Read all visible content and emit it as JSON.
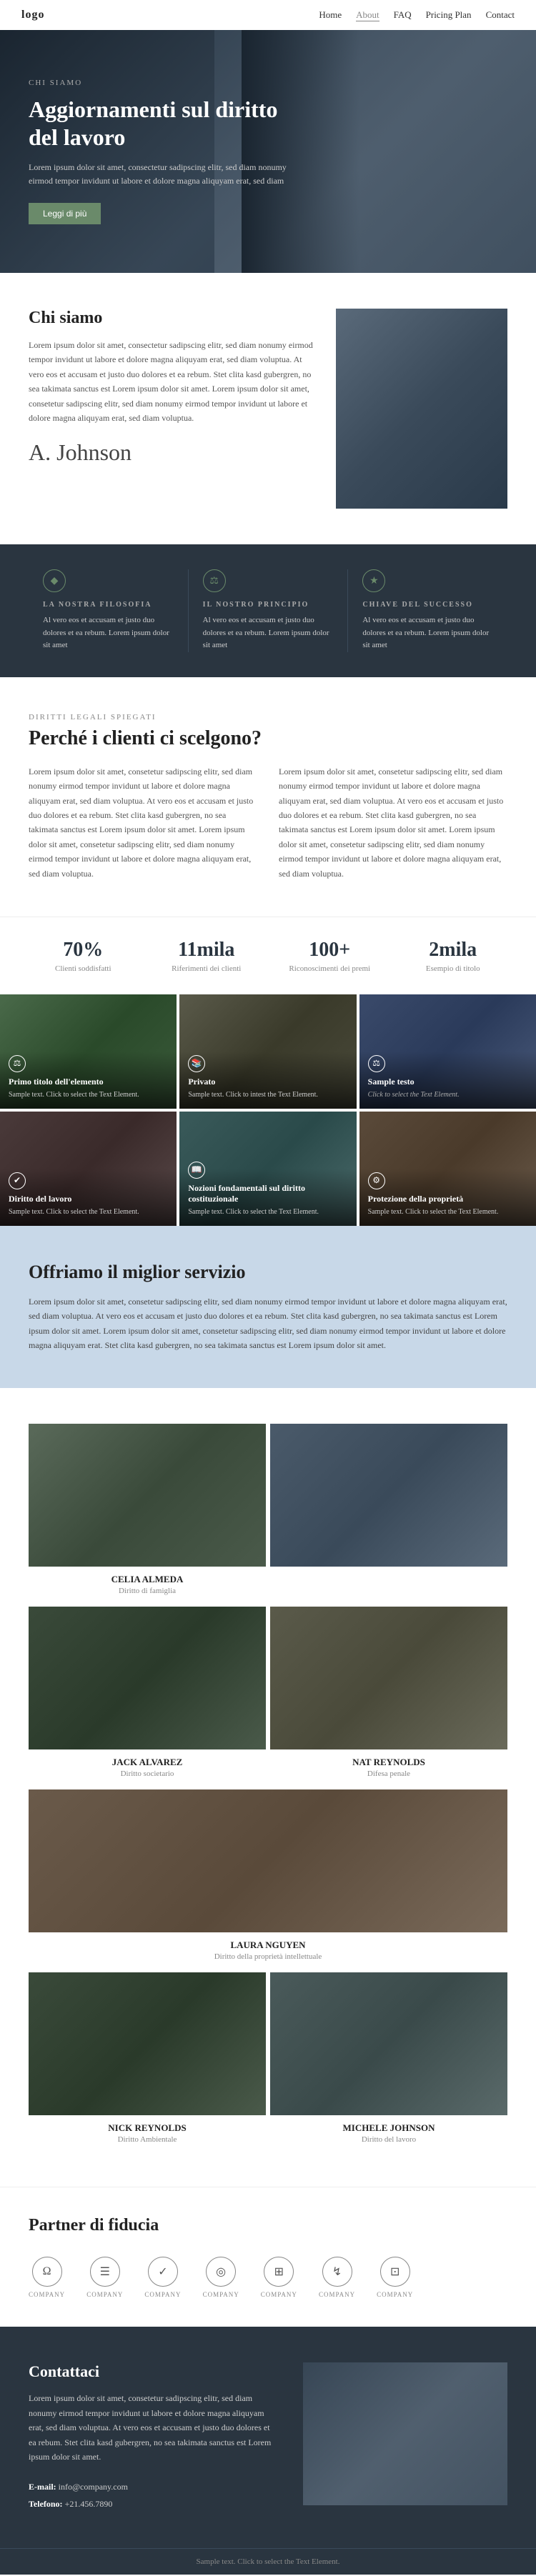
{
  "nav": {
    "logo": "logo",
    "links": [
      {
        "label": "Home",
        "active": false
      },
      {
        "label": "About",
        "active": true
      },
      {
        "label": "FAQ",
        "active": false
      },
      {
        "label": "Pricing Plan",
        "active": false
      },
      {
        "label": "Contact",
        "active": false
      }
    ]
  },
  "hero": {
    "tag": "CHI SIAMO",
    "title": "Aggiornamenti sul diritto del lavoro",
    "description": "Lorem ipsum dolor sit amet, consectetur sadipscing elitr, sed diam nonumy eirmod tempor invidunt ut labore et dolore magna aliquyam erat, sed diam",
    "button_label": "Leggi di più"
  },
  "chi_siamo": {
    "heading": "Chi siamo",
    "text": "Lorem ipsum dolor sit amet, consectetur sadipscing elitr, sed diam nonumy eirmod tempor invidunt ut labore et dolore magna aliquyam erat, sed diam voluptua. At vero eos et accusam et justo duo dolores et ea rebum. Stet clita kasd gubergren, no sea takimata sanctus est Lorem ipsum dolor sit amet. Lorem ipsum dolor sit amet, consetetur sadipscing elitr, sed diam nonumy eirmod tempor invidunt ut labore et dolore magna aliquyam erat, sed diam voluptua.",
    "signature": "A. Johnson"
  },
  "philosophy": {
    "items": [
      {
        "icon": "◆",
        "title": "LA NOSTRA FILOSOFIA",
        "text": "Al vero eos et accusam et justo duo dolores et ea rebum. Lorem ipsum dolor sit amet"
      },
      {
        "icon": "⚖",
        "title": "IL NOSTRO PRINCIPIO",
        "text": "Al vero eos et accusam et justo duo dolores et ea rebum. Lorem ipsum dolor sit amet"
      },
      {
        "icon": "★",
        "title": "CHIAVE DEL SUCCESSO",
        "text": "Al vero eos et accusam et justo duo dolores et ea rebum. Lorem ipsum dolor sit amet"
      }
    ]
  },
  "perche": {
    "tag": "DIRITTI LEGALI SPIEGATI",
    "title": "Perché i clienti ci scelgono?",
    "text_left": "Lorem ipsum dolor sit amet, consetetur sadipscing elitr, sed diam nonumy eirmod tempor invidunt ut labore et dolore magna aliquyam erat, sed diam voluptua. At vero eos et accusam et justo duo dolores et ea rebum. Stet clita kasd gubergren, no sea takimata sanctus est Lorem ipsum dolor sit amet. Lorem ipsum dolor sit amet, consetetur sadipscing elitr, sed diam nonumy eirmod tempor invidunt ut labore et dolore magna aliquyam erat, sed diam voluptua.",
    "text_right": "Lorem ipsum dolor sit amet, consetetur sadipscing elitr, sed diam nonumy eirmod tempor invidunt ut labore et dolore magna aliquyam erat, sed diam voluptua. At vero eos et accusam et justo duo dolores et ea rebum. Stet clita kasd gubergren, no sea takimata sanctus est Lorem ipsum dolor sit amet. Lorem ipsum dolor sit amet, consetetur sadipscing elitr, sed diam nonumy eirmod tempor invidunt ut labore et dolore magna aliquyam erat, sed diam voluptua."
  },
  "stats": [
    {
      "number": "70%",
      "label": "Clienti soddisfatti"
    },
    {
      "number": "11mila",
      "label": "Riferimenti dei clienti"
    },
    {
      "number": "100+",
      "label": "Riconoscimenti dei premi"
    },
    {
      "number": "2mila",
      "label": "Esempio di titolo"
    }
  ],
  "grid_cards": [
    {
      "icon": "⚖",
      "title": "Primo titolo dell'elemento",
      "sample": "Sample text. Click to select the Text Element.",
      "bg": "bg-1"
    },
    {
      "icon": "📚",
      "title": "Privato",
      "sample": "Sample text. Click to intest the Text Element.",
      "bg": "bg-2"
    },
    {
      "icon": "⚖",
      "title": "Sample testo",
      "sample": "Sample text. Click to select the Text Element.",
      "bg": "bg-3"
    },
    {
      "icon": "✔",
      "title": "Diritto del lavoro",
      "sample": "Sample text. Click to select the Text Element.",
      "bg": "bg-4"
    },
    {
      "icon": "📖",
      "title": "Nozioni fondamentali sul diritto costituzionale",
      "sample": "Sample text. Click to select the Text Element.",
      "bg": "bg-5"
    },
    {
      "icon": "⚙",
      "title": "Protezione della proprietà",
      "sample": "Sample text. Click to select the Text Element.",
      "bg": "bg-6"
    }
  ],
  "service": {
    "title": "Offriamo il miglior servizio",
    "text": "Lorem ipsum dolor sit amet, consetetur sadipscing elitr, sed diam nonumy eirmod tempor invidunt ut labore et dolore magna aliquyam erat, sed diam voluptua. At vero eos et accusam et justo duo dolores et ea rebum. Stet clita kasd gubergren, no sea takimata sanctus est Lorem ipsum dolor sit amet. Lorem ipsum dolor sit amet, consetetur sadipscing elitr, sed diam nonumy eirmod tempor invidunt ut labore et dolore magna aliquyam erat. Stet clita kasd gubergren, no sea takimata sanctus est Lorem ipsum dolor sit amet."
  },
  "team": {
    "members": [
      {
        "name": "CELIA ALMEDA",
        "role": "Diritto di famiglia",
        "bg": "team-bg-1",
        "size": "normal"
      },
      {
        "name": "",
        "role": "",
        "bg": "team-bg-2",
        "size": "normal"
      },
      {
        "name": "JACK ALVAREZ",
        "role": "Diritto societario",
        "bg": "team-bg-3",
        "size": "normal"
      },
      {
        "name": "NAT REYNOLDS",
        "role": "Difesa penale",
        "bg": "team-bg-4",
        "size": "normal"
      },
      {
        "name": "LAURA NGUYEN",
        "role": "Diritto della proprietà intellettuale",
        "bg": "team-bg-5",
        "size": "center"
      },
      {
        "name": "NICK REYNOLDS",
        "role": "Diritto Ambientale",
        "bg": "team-bg-3",
        "size": "normal"
      },
      {
        "name": "MICHELE JOHNSON",
        "role": "Diritto del lavoro",
        "bg": "team-bg-6",
        "size": "normal"
      }
    ]
  },
  "partner": {
    "title": "Partner di fiducia",
    "logos": [
      {
        "icon": "Ω",
        "label": "COMPANY"
      },
      {
        "icon": "☰",
        "label": "COMPANY"
      },
      {
        "icon": "✓",
        "label": "COMPANY"
      },
      {
        "icon": "◎",
        "label": "COMPANY"
      },
      {
        "icon": "⊞",
        "label": "COMPANY"
      },
      {
        "icon": "↯",
        "label": "COMPANY"
      },
      {
        "icon": "⊡",
        "label": "COMPANY"
      }
    ]
  },
  "contact": {
    "title": "Contattaci",
    "text": "Lorem ipsum dolor sit amet, consetetur sadipscing elitr, sed diam nonumy eirmod tempor invidunt ut labore et dolore magna aliquyam erat, sed diam voluptua. At vero eos et accusam et justo duo dolores et ea rebum. Stet clita kasd gubergren, no sea takimata sanctus est Lorem ipsum dolor sit amet.",
    "email_label": "E-mail:",
    "email": "info@company.com",
    "phone_label": "Telefono:",
    "phone": "+21.456.7890"
  },
  "footer": {
    "sample_text": "Sample text. Click to select the Text Element."
  }
}
